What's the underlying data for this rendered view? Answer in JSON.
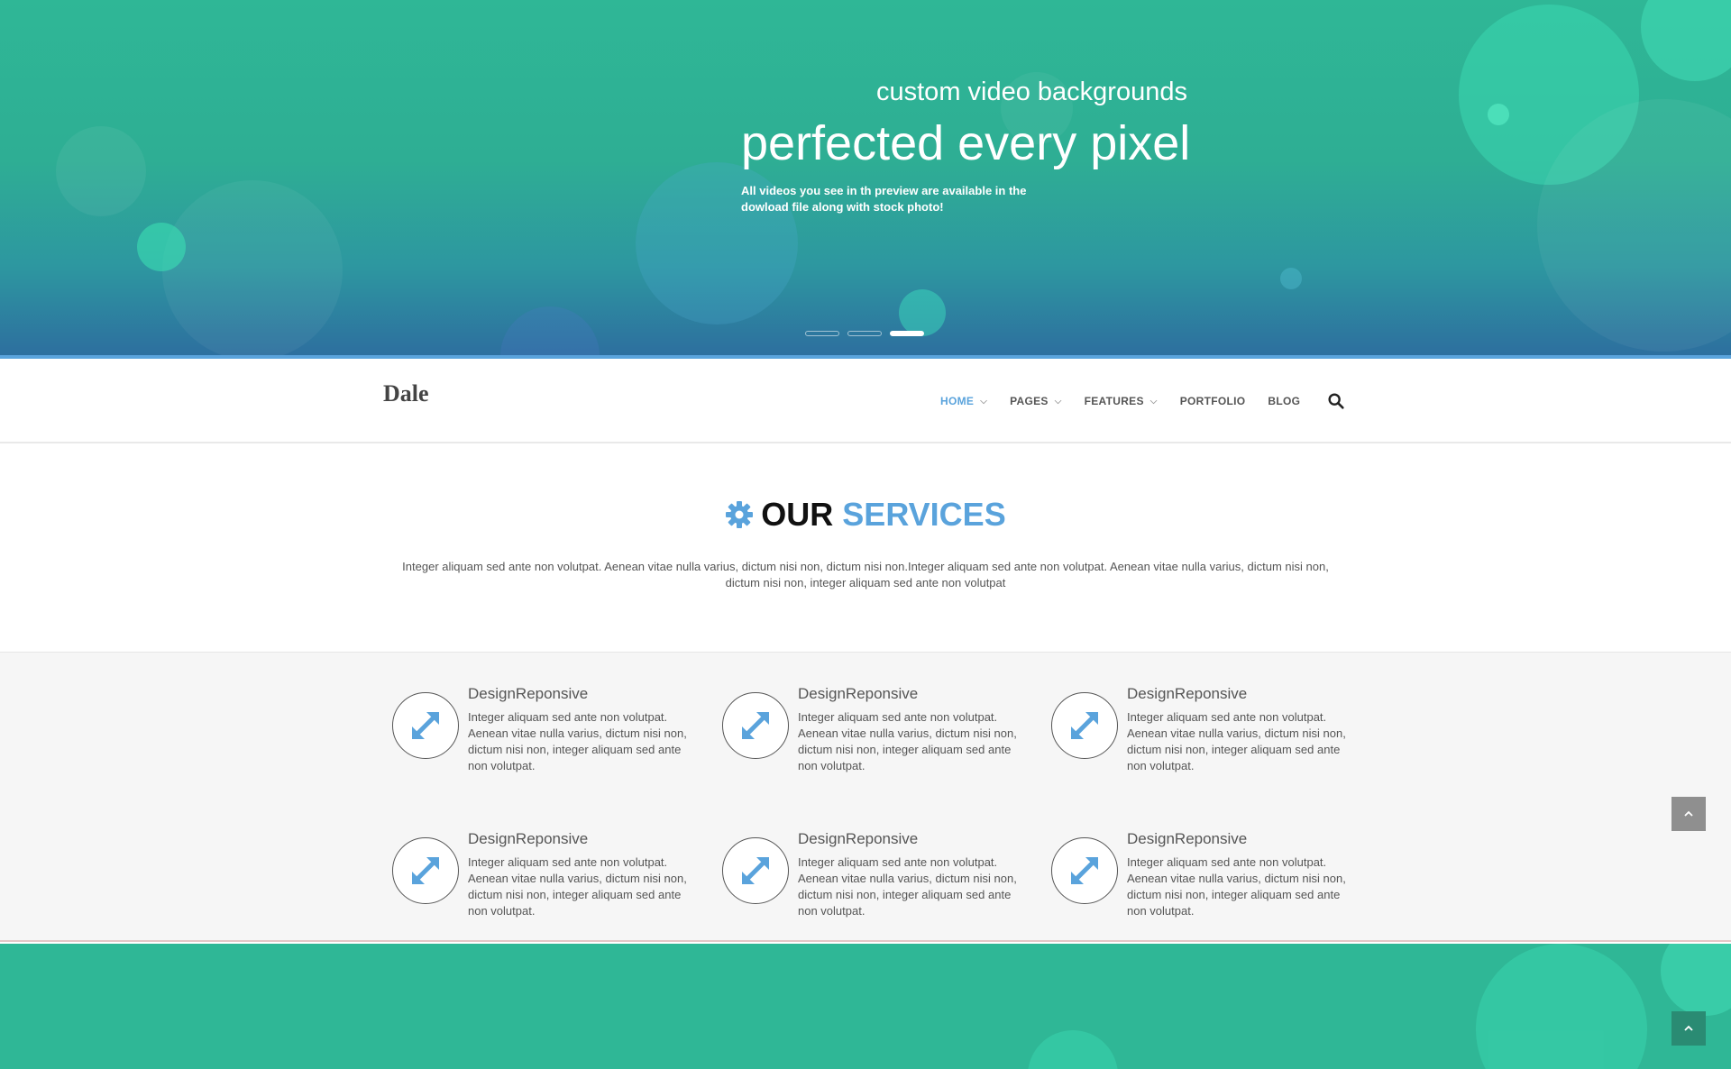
{
  "hero": {
    "subtitle": "custom video backgrounds",
    "title": "perfected every pixel",
    "description": "All videos you see in th preview are available in the dowload file along with stock photo!",
    "slides": 3,
    "active_slide": 3
  },
  "brand": {
    "name": "Dale"
  },
  "nav": {
    "items": [
      {
        "label": "HOME",
        "active": true,
        "has_dropdown": true
      },
      {
        "label": "PAGES",
        "active": false,
        "has_dropdown": true
      },
      {
        "label": "FEATURES",
        "active": false,
        "has_dropdown": true
      },
      {
        "label": "PORTFOLIO",
        "active": false,
        "has_dropdown": false
      },
      {
        "label": "BLOG",
        "active": false,
        "has_dropdown": false
      }
    ],
    "search_icon": "search-icon"
  },
  "services": {
    "title_part1": "OUR",
    "title_part2": "SERVICES",
    "icon": "gear-icon",
    "intro": "Integer aliquam sed ante non volutpat. Aenean vitae nulla varius, dictum nisi non, dictum nisi non.Integer aliquam sed ante non volutpat. Aenean vitae nulla varius, dictum nisi non, dictum nisi non, integer aliquam sed ante non volutpat",
    "items": [
      {
        "title": "DesignReponsive",
        "text": "Integer aliquam sed ante non volutpat. Aenean vitae nulla varius, dictum nisi non, dictum nisi non, integer aliquam sed ante non volutpat.",
        "icon": "expand-arrows-icon"
      },
      {
        "title": "DesignReponsive",
        "text": "Integer aliquam sed ante non volutpat. Aenean vitae nulla varius, dictum nisi non, dictum nisi non, integer aliquam sed ante non volutpat.",
        "icon": "expand-arrows-icon"
      },
      {
        "title": "DesignReponsive",
        "text": "Integer aliquam sed ante non volutpat. Aenean vitae nulla varius, dictum nisi non, dictum nisi non, integer aliquam sed ante non volutpat.",
        "icon": "expand-arrows-icon"
      },
      {
        "title": "DesignReponsive",
        "text": "Integer aliquam sed ante non volutpat. Aenean vitae nulla varius, dictum nisi non, dictum nisi non, integer aliquam sed ante non volutpat.",
        "icon": "expand-arrows-icon"
      },
      {
        "title": "DesignReponsive",
        "text": "Integer aliquam sed ante non volutpat. Aenean vitae nulla varius, dictum nisi non, dictum nisi non, integer aliquam sed ante non volutpat.",
        "icon": "expand-arrows-icon"
      },
      {
        "title": "DesignReponsive",
        "text": "Integer aliquam sed ante non volutpat. Aenean vitae nulla varius, dictum nisi non, dictum nisi non, integer aliquam sed ante non volutpat.",
        "icon": "expand-arrows-icon"
      }
    ]
  },
  "colors": {
    "accent": "#5aa3dc",
    "hero_green": "#2fb796",
    "hero_blue": "#2d6f9f"
  }
}
